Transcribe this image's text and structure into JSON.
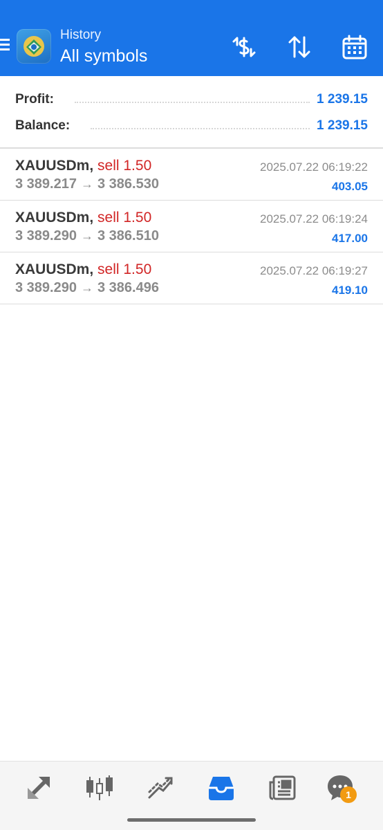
{
  "header": {
    "subtitle": "History",
    "title": "All symbols",
    "icons": [
      "menu-icon",
      "metatrader-logo",
      "dollar-exchange-icon",
      "sort-icon",
      "calendar-icon"
    ]
  },
  "summary": {
    "profit_label": "Profit:",
    "profit_value": "1 239.15",
    "balance_label": "Balance:",
    "balance_value": "1 239.15"
  },
  "deals": [
    {
      "symbol": "XAUUSDm,",
      "type": "sell 1.50",
      "open_price": "3 389.217",
      "close_price": "3 386.530",
      "time": "2025.07.22 06:19:22",
      "profit": "403.05"
    },
    {
      "symbol": "XAUUSDm,",
      "type": "sell 1.50",
      "open_price": "3 389.290",
      "close_price": "3 386.510",
      "time": "2025.07.22 06:19:24",
      "profit": "417.00"
    },
    {
      "symbol": "XAUUSDm,",
      "type": "sell 1.50",
      "open_price": "3 389.290",
      "close_price": "3 386.496",
      "time": "2025.07.22 06:19:27",
      "profit": "419.10"
    }
  ],
  "arrow_glyph": "→",
  "bottom_nav": {
    "items": [
      "quotes-icon",
      "chart-icon",
      "trade-icon",
      "history-icon",
      "news-icon",
      "chat-icon"
    ],
    "active": "history-icon",
    "chat_badge": "1"
  },
  "colors": {
    "accent": "#1a75e8",
    "sell": "#d12525",
    "badge": "#f29b12"
  }
}
